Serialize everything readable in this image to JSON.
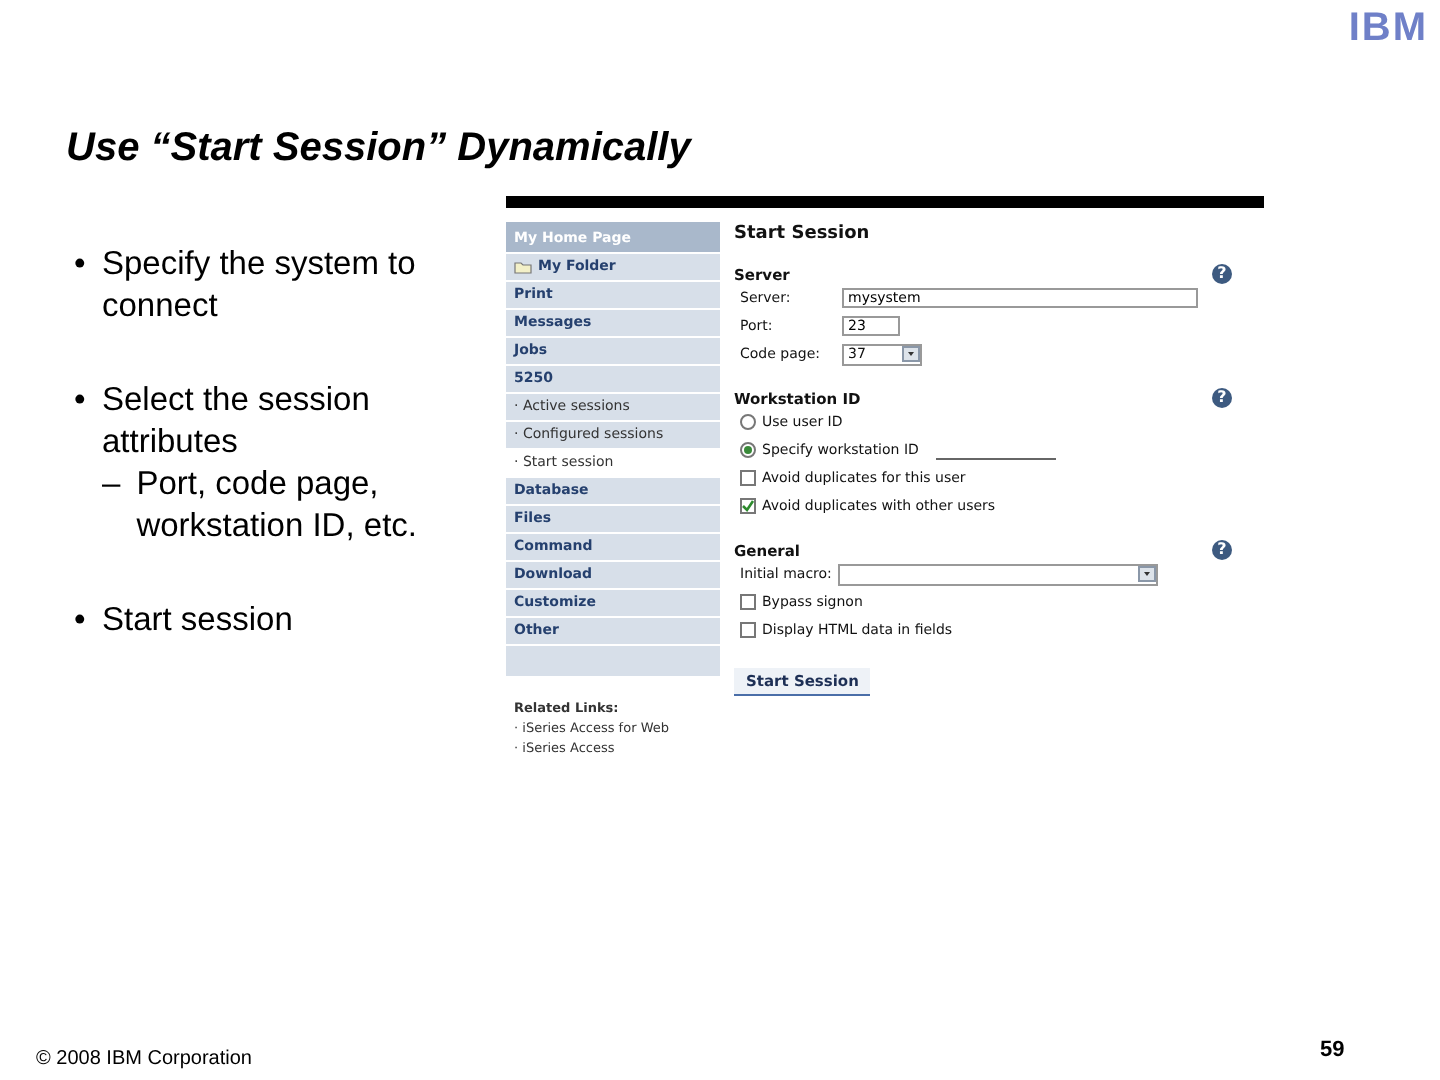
{
  "logo": "IBM",
  "title": "Use “Start Session” Dynamically",
  "bullets": [
    {
      "marker": "•",
      "text": "Specify the system to connect"
    },
    {
      "marker": "•",
      "text": "Select the session attributes",
      "children": [
        {
          "marker": "–",
          "text": "Port, code page, workstation ID, etc."
        }
      ]
    },
    {
      "marker": "•",
      "text": "Start session"
    }
  ],
  "sidebar": {
    "items": [
      {
        "kind": "top",
        "label": "My Home Page",
        "selected": false
      },
      {
        "kind": "folder",
        "label": "My Folder",
        "selected": false
      },
      {
        "kind": "link",
        "label": "Print",
        "selected": false
      },
      {
        "kind": "link",
        "label": "Messages",
        "selected": false
      },
      {
        "kind": "link",
        "label": "Jobs",
        "selected": false
      },
      {
        "kind": "link",
        "label": "5250",
        "selected": false
      },
      {
        "kind": "sub",
        "label": "· Active sessions",
        "selected": false
      },
      {
        "kind": "sub",
        "label": "· Configured sessions",
        "selected": false
      },
      {
        "kind": "sub",
        "label": "· Start session",
        "selected": true
      },
      {
        "kind": "link",
        "label": "Database",
        "selected": false
      },
      {
        "kind": "link",
        "label": "Files",
        "selected": false
      },
      {
        "kind": "link",
        "label": "Command",
        "selected": false
      },
      {
        "kind": "link",
        "label": "Download",
        "selected": false
      },
      {
        "kind": "link",
        "label": "Customize",
        "selected": false
      },
      {
        "kind": "link",
        "label": "Other",
        "selected": false
      }
    ],
    "related_heading": "Related Links:",
    "related_links": [
      "· iSeries Access for Web",
      "· iSeries Access"
    ]
  },
  "form": {
    "title": "Start Session",
    "sections": [
      {
        "heading": "Server",
        "help": "?",
        "rows": [
          {
            "kind": "text",
            "label": "Server:",
            "value": "mysystem",
            "wide": true
          },
          {
            "kind": "text",
            "label": "Port:",
            "value": "23",
            "wide": false
          },
          {
            "kind": "select",
            "label": "Code page:",
            "value": "37",
            "wide": false
          }
        ]
      },
      {
        "heading": "Workstation ID",
        "help": "?",
        "rows": [
          {
            "kind": "radio",
            "label": "Use user ID",
            "selected": false
          },
          {
            "kind": "radio_field",
            "label": "Specify workstation ID",
            "selected": true
          },
          {
            "kind": "checkbox",
            "label": "Avoid duplicates for this user",
            "checked": false
          },
          {
            "kind": "checkbox",
            "label": "Avoid duplicates with other users",
            "checked": true
          }
        ]
      },
      {
        "heading": "General",
        "help": "?",
        "rows": [
          {
            "kind": "select",
            "label": "Initial macro:",
            "wide": true
          },
          {
            "kind": "checkbox",
            "label": "Bypass signon",
            "checked": false
          },
          {
            "kind": "checkbox",
            "label": "Display HTML data in fields",
            "checked": false
          }
        ]
      }
    ],
    "button": "Start Session"
  },
  "footer": {
    "copyright": "© 2008 IBM Corporation",
    "page": "59"
  }
}
